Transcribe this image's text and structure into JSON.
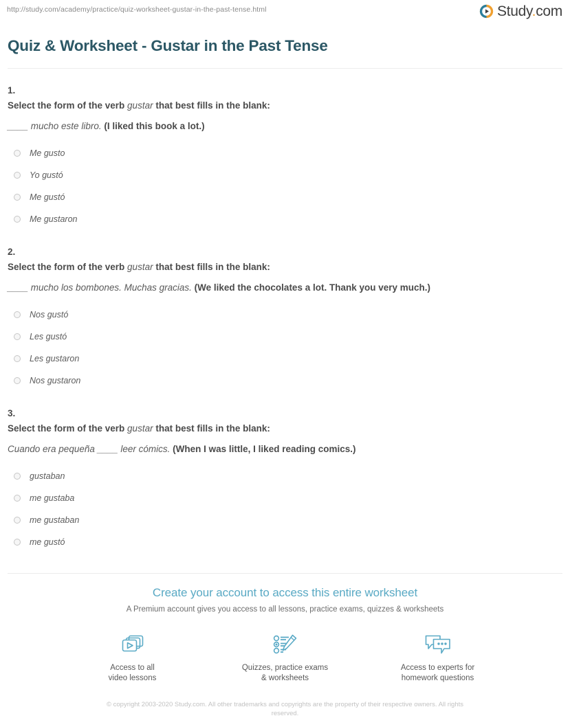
{
  "header": {
    "url": "http://study.com/academy/practice/quiz-worksheet-gustar-in-the-past-tense.html",
    "logo_icon": "play-circle-icon",
    "logo_name": "Study",
    "logo_dot": ".",
    "logo_tld": "com"
  },
  "title": "Quiz & Worksheet - Gustar in the Past Tense",
  "questions": [
    {
      "number": "1.",
      "prompt_before": "Select the form of the verb ",
      "prompt_verb": "gustar",
      "prompt_after": " that best fills in the blank:",
      "sentence_es": "____ mucho este libro.",
      "sentence_en": " (I liked this book a lot.)",
      "options": [
        "Me gusto",
        "Yo gustó",
        "Me gustó",
        "Me gustaron"
      ]
    },
    {
      "number": "2.",
      "prompt_before": "Select the form of the verb ",
      "prompt_verb": "gustar",
      "prompt_after": " that best fills in the blank:",
      "sentence_es": "____ mucho los bombones. Muchas gracias.",
      "sentence_en": " (We liked the chocolates a lot. Thank you very much.)",
      "options": [
        "Nos gustó",
        "Les gustó",
        "Les gustaron",
        "Nos gustaron"
      ]
    },
    {
      "number": "3.",
      "prompt_before": "Select the form of the verb ",
      "prompt_verb": "gustar",
      "prompt_after": " that best fills in the blank:",
      "sentence_es": "Cuando era pequeña ____ leer cómics.",
      "sentence_en": " (When I was little, I liked reading comics.)",
      "options": [
        "gustaban",
        "me gustaba",
        "me gustaban",
        "me gustó"
      ]
    }
  ],
  "promo": {
    "title": "Create your account to access this entire worksheet",
    "subtitle": "A Premium account gives you access to all lessons, practice exams, quizzes & worksheets",
    "features": [
      {
        "icon": "video-lessons-icon",
        "line1": "Access to all",
        "line2": "video lessons"
      },
      {
        "icon": "quiz-pencil-icon",
        "line1": "Quizzes, practice exams",
        "line2": "& worksheets"
      },
      {
        "icon": "chat-bubbles-icon",
        "line1": "Access to experts for",
        "line2": "homework questions"
      }
    ]
  },
  "copyright": "© copyright 2003-2020 Study.com. All other trademarks and copyrights are the property of their respective owners. All rights reserved.",
  "colors": {
    "title": "#2b5765",
    "promo_accent": "#59a9c4",
    "logo_orange": "#f0a030",
    "logo_teal": "#2a7f9e",
    "body_text": "#4a4a4a"
  }
}
